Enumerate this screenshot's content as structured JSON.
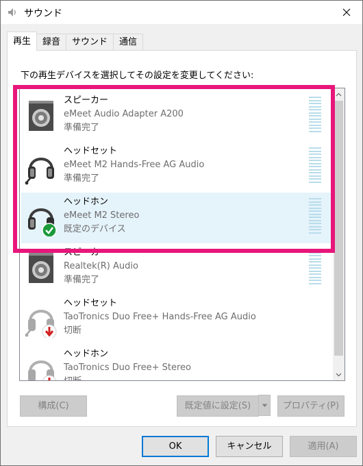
{
  "window": {
    "title": "サウンド",
    "icon": "speaker-icon",
    "close": "close-icon"
  },
  "tabs": [
    {
      "label": "再生",
      "active": true
    },
    {
      "label": "録音",
      "active": false
    },
    {
      "label": "サウンド",
      "active": false
    },
    {
      "label": "通信",
      "active": false
    }
  ],
  "instruction": "下の再生デバイスを選択してその設定を変更してください:",
  "devices": [
    {
      "name": "スピーカー",
      "description": "eMeet Audio Adapter A200",
      "status": "準備完了",
      "icon": "speaker-icon",
      "selected": false
    },
    {
      "name": "ヘッドセット",
      "description": "eMeet M2 Hands-Free AG Audio",
      "status": "準備完了",
      "icon": "headset-icon",
      "selected": false
    },
    {
      "name": "ヘッドホン",
      "description": "eMeet M2 Stereo",
      "status": "既定のデバイス",
      "icon": "headphones-default-icon",
      "selected": true
    },
    {
      "name": "スピーカー",
      "description": "Realtek(R) Audio",
      "status": "準備完了",
      "icon": "speaker-icon",
      "selected": false
    },
    {
      "name": "ヘッドセット",
      "description": "TaoTronics Duo Free+ Hands-Free AG Audio",
      "status": "切断",
      "icon": "headset-disconnected-icon",
      "selected": false
    },
    {
      "name": "ヘッドホン",
      "description": "TaoTronics Duo Free+ Stereo",
      "status": "切断",
      "icon": "headphones-disconnected-icon",
      "selected": false
    }
  ],
  "buttons": {
    "configure": "構成(C)",
    "set_default": "既定値に設定(S)",
    "properties": "プロパティ(P)",
    "ok": "OK",
    "cancel": "キャンセル",
    "apply": "適用(A)"
  },
  "colors": {
    "highlight": "#e8167b",
    "selection": "#e5f3fb",
    "accent": "#0078d7",
    "check": "#1a9a3a",
    "disconnected": "#d32020"
  }
}
